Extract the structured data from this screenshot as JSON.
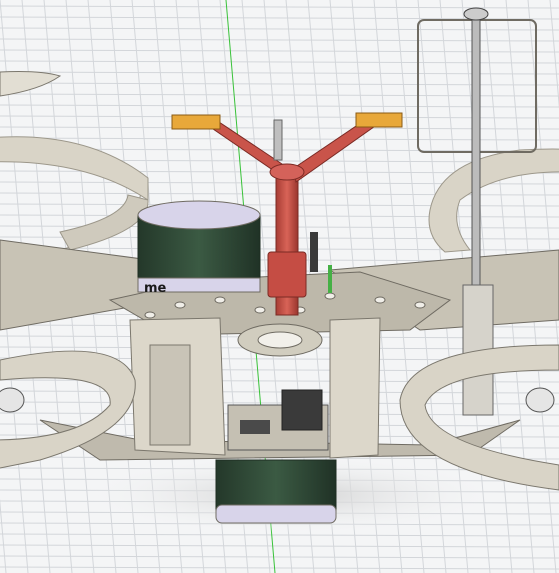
{
  "viewport": {
    "background": "#f4f5f6",
    "grid_color": "#d3d6da",
    "axis_color": "#39c239"
  },
  "model": {
    "frame_color": "#d9d4c7",
    "frame_dark": "#9c978a",
    "mast_color": "#c9544a",
    "mast_tip_color": "#e8a83a",
    "battery_color": "#2f4a36",
    "battery_cap_color": "#d8d4ea",
    "battery_label": "me"
  }
}
